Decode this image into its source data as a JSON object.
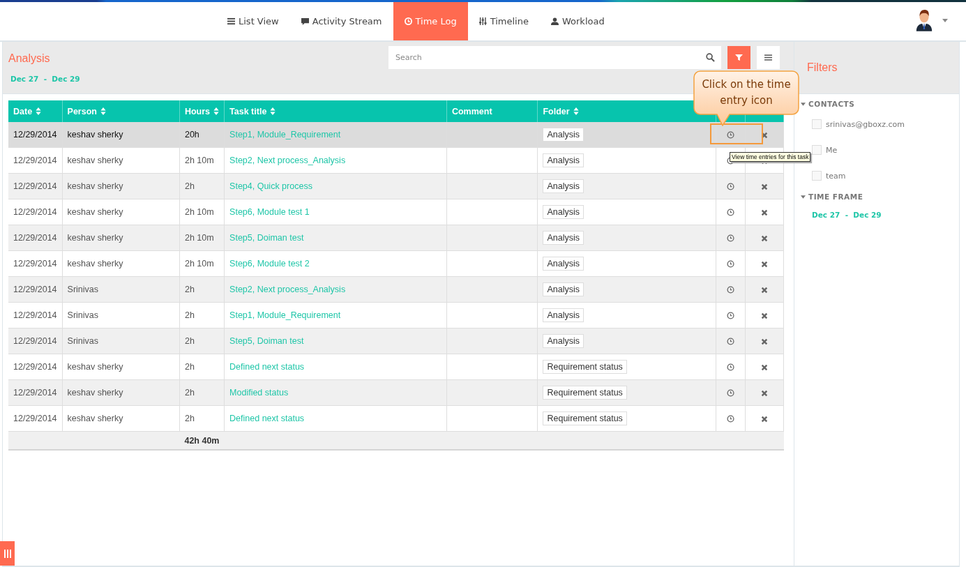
{
  "nav": {
    "tabs": [
      {
        "label": "List View",
        "selected": false
      },
      {
        "label": "Activity Stream",
        "selected": false
      },
      {
        "label": "Time Log",
        "selected": true
      },
      {
        "label": "Timeline",
        "selected": false
      },
      {
        "label": "Workload",
        "selected": false
      }
    ]
  },
  "analysis": {
    "title": "Analysis",
    "date_from": "Dec 27",
    "date_sep": "-",
    "date_to": "Dec 29",
    "search": {
      "placeholder": "Search"
    }
  },
  "table": {
    "columns": [
      {
        "label": "Date",
        "sortable": true
      },
      {
        "label": "Person",
        "sortable": true
      },
      {
        "label": "Hours",
        "sortable": true
      },
      {
        "label": "Task title",
        "sortable": true
      },
      {
        "label": "Comment",
        "sortable": false
      },
      {
        "label": "Folder",
        "sortable": true
      }
    ],
    "rows": [
      {
        "date": "12/29/2014",
        "person": "keshav sherky",
        "hours": "20h",
        "task": "Step1, Module_Requirement",
        "folder": "Analysis",
        "selected": true
      },
      {
        "date": "12/29/2014",
        "person": "keshav sherky",
        "hours": "2h 10m",
        "task": "Step2, Next process_Analysis",
        "folder": "Analysis",
        "selected": false
      },
      {
        "date": "12/29/2014",
        "person": "keshav sherky",
        "hours": "2h",
        "task": "Step4, Quick process",
        "folder": "Analysis",
        "selected": false
      },
      {
        "date": "12/29/2014",
        "person": "keshav sherky",
        "hours": "2h 10m",
        "task": "Step6, Module test 1",
        "folder": "Analysis",
        "selected": false
      },
      {
        "date": "12/29/2014",
        "person": "keshav sherky",
        "hours": "2h 10m",
        "task": "Step5, Doiman test",
        "folder": "Analysis",
        "selected": false
      },
      {
        "date": "12/29/2014",
        "person": "keshav sherky",
        "hours": "2h 10m",
        "task": "Step6, Module test 2",
        "folder": "Analysis",
        "selected": false
      },
      {
        "date": "12/29/2014",
        "person": "Srinivas",
        "hours": "2h",
        "task": "Step2, Next process_Analysis",
        "folder": "Analysis",
        "selected": false
      },
      {
        "date": "12/29/2014",
        "person": "Srinivas",
        "hours": "2h",
        "task": "Step1, Module_Requirement",
        "folder": "Analysis",
        "selected": false
      },
      {
        "date": "12/29/2014",
        "person": "Srinivas",
        "hours": "2h",
        "task": "Step5, Doiman test",
        "folder": "Analysis",
        "selected": false
      },
      {
        "date": "12/29/2014",
        "person": "keshav sherky",
        "hours": "2h",
        "task": "Defined next status",
        "folder": "Requirement status",
        "selected": false
      },
      {
        "date": "12/29/2014",
        "person": "keshav sherky",
        "hours": "2h",
        "task": "Modified status",
        "folder": "Requirement status",
        "selected": false
      },
      {
        "date": "12/29/2014",
        "person": "keshav sherky",
        "hours": "2h",
        "task": "Defined next status",
        "folder": "Requirement status",
        "selected": false
      }
    ],
    "total": "42h 40m"
  },
  "filters": {
    "title": "Filters",
    "contacts": {
      "heading": "CONTACTS",
      "expanded": true,
      "items": [
        {
          "label": "srinivas@gboxz.com",
          "checked": false
        },
        {
          "label": "Me",
          "checked": false
        },
        {
          "label": "team",
          "checked": false
        }
      ]
    },
    "time_frame": {
      "heading": "TIME FRAME",
      "expanded": true,
      "date_from": "Dec 27",
      "date_sep": "-",
      "date_to": "Dec 29"
    }
  },
  "callout": {
    "text": "Click on the time entry icon"
  },
  "tooltip": {
    "text": "View time entries for this task"
  }
}
